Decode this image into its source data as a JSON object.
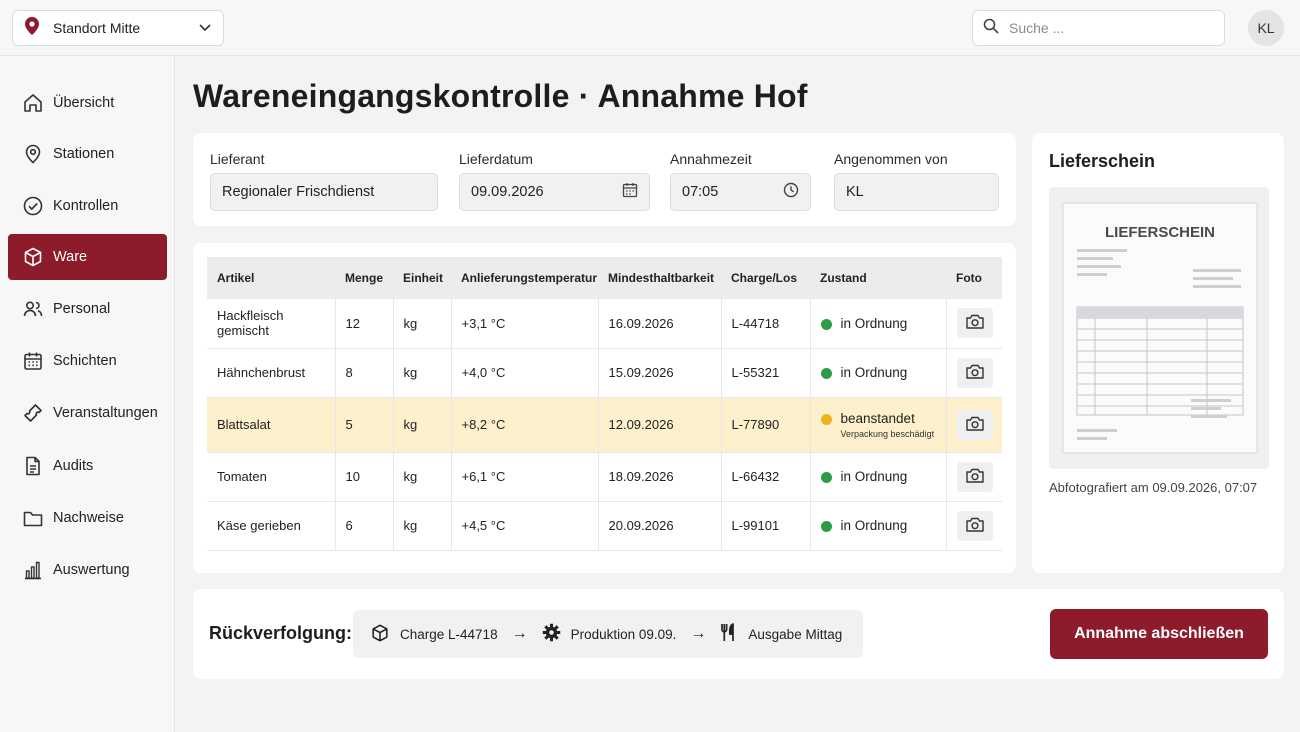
{
  "topbar": {
    "location": "Standort Mitte",
    "search_placeholder": "Suche ...",
    "user_initials": "KL"
  },
  "sidebar": {
    "items": [
      {
        "label": "Übersicht",
        "icon": "home-icon"
      },
      {
        "label": "Stationen",
        "icon": "map-pin-icon"
      },
      {
        "label": "Kontrollen",
        "icon": "check-circle-icon"
      },
      {
        "label": "Ware",
        "icon": "package-icon",
        "active": true
      },
      {
        "label": "Personal",
        "icon": "users-icon"
      },
      {
        "label": "Schichten",
        "icon": "calendar-icon"
      },
      {
        "label": "Veranstaltungen",
        "icon": "ticket-icon"
      },
      {
        "label": "Audits",
        "icon": "document-icon"
      },
      {
        "label": "Nachweise",
        "icon": "folder-icon"
      },
      {
        "label": "Auswertung",
        "icon": "bar-chart-icon"
      }
    ]
  },
  "page": {
    "title": "Wareneingangskontrolle · Annahme Hof"
  },
  "form": {
    "supplier_label": "Lieferant",
    "supplier_value": "Regionaler Frischdienst",
    "date_label": "Lieferdatum",
    "date_value": "09.09.2026",
    "time_label": "Annahmezeit",
    "time_value": "07:05",
    "accepted_label": "Angenommen von",
    "accepted_value": "KL"
  },
  "table": {
    "headers": [
      "Artikel",
      "Menge",
      "Einheit",
      "Anlieferungstemperatur",
      "Mindesthaltbarkeit",
      "Charge/Los",
      "Zustand",
      "Foto"
    ],
    "rows": [
      {
        "article": "Hackfleisch gemischt",
        "qty": "12",
        "unit": "kg",
        "temp": "+3,1 °C",
        "mhd": "16.09.2026",
        "batch": "L-44718",
        "status": "in Ordnung",
        "status_note": ""
      },
      {
        "article": "Hähnchenbrust",
        "qty": "8",
        "unit": "kg",
        "temp": "+4,0 °C",
        "mhd": "15.09.2026",
        "batch": "L-55321",
        "status": "in Ordnung",
        "status_note": ""
      },
      {
        "article": "Blattsalat",
        "qty": "5",
        "unit": "kg",
        "temp": "+8,2 °C",
        "mhd": "12.09.2026",
        "batch": "L-77890",
        "status": "beanstandet",
        "status_note": "Verpackung beschädigt"
      },
      {
        "article": "Tomaten",
        "qty": "10",
        "unit": "kg",
        "temp": "+6,1 °C",
        "mhd": "18.09.2026",
        "batch": "L-66432",
        "status": "in Ordnung",
        "status_note": ""
      },
      {
        "article": "Käse gerieben",
        "qty": "6",
        "unit": "kg",
        "temp": "+4,5 °C",
        "mhd": "20.09.2026",
        "batch": "L-99101",
        "status": "in Ordnung",
        "status_note": ""
      }
    ]
  },
  "delivery_note": {
    "title": "Lieferschein",
    "doc_heading": "LIEFERSCHEIN",
    "caption": "Abfotografiert am 09.09.2026, 07:07"
  },
  "traceability": {
    "label": "Rückverfolgung:",
    "steps": [
      "Charge L-44718",
      "Produktion 09.09.",
      "Ausgabe Mittag"
    ],
    "arrow": "→"
  },
  "actions": {
    "submit_label": "Annahme abschließen"
  },
  "colors": {
    "accent": "#8e1b2c",
    "ok": "#2e9b48",
    "warning": "#f1b31c",
    "warning_row": "#fdf0cc"
  }
}
